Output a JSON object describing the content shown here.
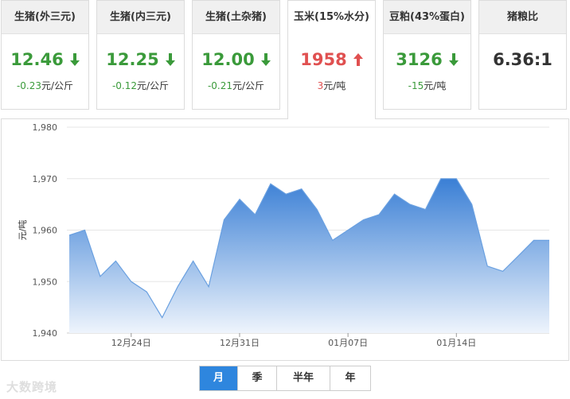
{
  "cards": [
    {
      "title": "生猪(外三元)",
      "price": "12.46",
      "dir": "down",
      "change": "-0.23",
      "unit": "元/公斤"
    },
    {
      "title": "生猪(内三元)",
      "price": "12.25",
      "dir": "down",
      "change": "-0.12",
      "unit": "元/公斤"
    },
    {
      "title": "生猪(土杂猪)",
      "price": "12.00",
      "dir": "down",
      "change": "-0.21",
      "unit": "元/公斤"
    },
    {
      "title": "玉米(15%水分)",
      "price": "1958",
      "dir": "up",
      "change": "3",
      "unit": "元/吨"
    },
    {
      "title": "豆粕(43%蛋白)",
      "price": "3126",
      "dir": "down",
      "change": "-15",
      "unit": "元/吨"
    },
    {
      "title": "猪粮比",
      "price": "6.36:1"
    }
  ],
  "periods": [
    {
      "label": "月",
      "active": true
    },
    {
      "label": "季",
      "active": false
    },
    {
      "label": "半年",
      "active": false
    },
    {
      "label": "年",
      "active": false
    }
  ],
  "watermark": "大数跨境",
  "colors": {
    "down": "#3a9a3a",
    "up": "#e05050",
    "accent": "#2e86de",
    "area_top": "#3a7fd5",
    "area_bottom": "#eef4fc"
  },
  "chart_data": {
    "type": "area",
    "ylabel": "元/吨",
    "ylim": [
      1940,
      1980
    ],
    "yticks": [
      1940,
      1950,
      1960,
      1970,
      1980
    ],
    "ytick_labels": [
      "1,940",
      "1,950",
      "1,960",
      "1,970",
      "1,980"
    ],
    "x_tick_labels": [
      {
        "label": "12月24日",
        "date": "12-24"
      },
      {
        "label": "12月31日",
        "date": "12-31"
      },
      {
        "label": "01月07日",
        "date": "01-07"
      },
      {
        "label": "01月14日",
        "date": "01-14"
      }
    ],
    "grid": true,
    "series": [
      {
        "x": [
          "12-20",
          "12-21",
          "12-22",
          "12-23",
          "12-24",
          "12-25",
          "12-26",
          "12-27",
          "12-28",
          "12-29",
          "12-30",
          "12-31",
          "01-01",
          "01-02",
          "01-03",
          "01-04",
          "01-05",
          "01-06",
          "01-07",
          "01-08",
          "01-09",
          "01-10",
          "01-11",
          "01-12",
          "01-13",
          "01-14",
          "01-15",
          "01-16",
          "01-17",
          "01-18",
          "01-19",
          "01-20"
        ],
        "values": [
          1959,
          1960,
          1951,
          1954,
          1950,
          1948,
          1943,
          1949,
          1954,
          1949,
          1962,
          1966,
          1963,
          1969,
          1967,
          1968,
          1964,
          1958,
          1960,
          1962,
          1963,
          1967,
          1965,
          1964,
          1970,
          1970,
          1965,
          1953,
          1952,
          1955,
          1958,
          1958
        ]
      }
    ]
  }
}
